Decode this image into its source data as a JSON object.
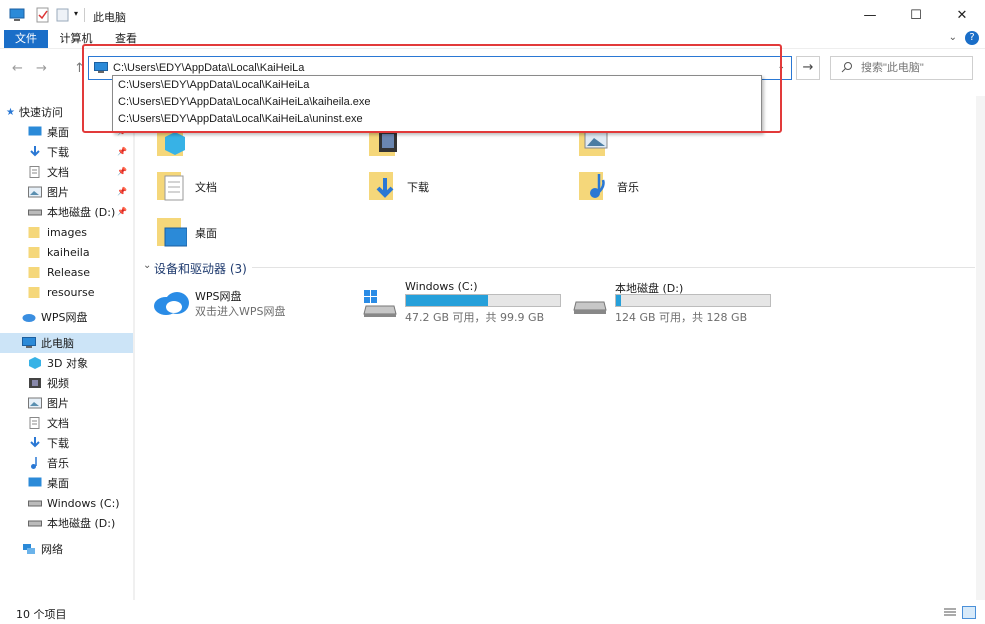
{
  "window": {
    "title": "此电脑",
    "minimize": "—",
    "maximize": "☐",
    "close": "✕"
  },
  "ribbon": {
    "tabs": [
      "文件",
      "计算机",
      "查看"
    ],
    "toggle": "⌄",
    "help": "?"
  },
  "nav": {
    "back": "←",
    "forward": "→",
    "up": "↑",
    "address_value": "C:\\Users\\EDY\\AppData\\Local\\KaiHeiLa",
    "dropdown": "⌄",
    "go": "→",
    "search_placeholder": "搜索\"此电脑\""
  },
  "autocomplete": [
    "C:\\Users\\EDY\\AppData\\Local\\KaiHeiLa",
    "C:\\Users\\EDY\\AppData\\Local\\KaiHeiLa\\kaiheila.exe",
    "C:\\Users\\EDY\\AppData\\Local\\KaiHeiLa\\uninst.exe"
  ],
  "sidebar": {
    "items": [
      {
        "label": "快速访问",
        "icon": "star-icon"
      },
      {
        "label": "桌面",
        "icon": "desktop-icon",
        "pinned": true
      },
      {
        "label": "下载",
        "icon": "download-icon",
        "pinned": true
      },
      {
        "label": "文档",
        "icon": "document-icon",
        "pinned": true
      },
      {
        "label": "图片",
        "icon": "pictures-icon",
        "pinned": true
      },
      {
        "label": "本地磁盘 (D:)",
        "icon": "drive-icon",
        "pinned": true
      },
      {
        "label": "images",
        "icon": "folder-icon"
      },
      {
        "label": "kaiheila",
        "icon": "folder-icon"
      },
      {
        "label": "Release",
        "icon": "folder-icon"
      },
      {
        "label": "resourse",
        "icon": "folder-icon"
      },
      {
        "label": "WPS网盘",
        "icon": "cloud-icon"
      },
      {
        "label": "此电脑",
        "icon": "computer-icon",
        "selected": true
      },
      {
        "label": "3D 对象",
        "icon": "3d-objects-icon"
      },
      {
        "label": "视频",
        "icon": "video-icon"
      },
      {
        "label": "图片",
        "icon": "pictures-icon"
      },
      {
        "label": "文档",
        "icon": "document-icon"
      },
      {
        "label": "下载",
        "icon": "download-icon"
      },
      {
        "label": "音乐",
        "icon": "music-icon"
      },
      {
        "label": "桌面",
        "icon": "desktop-icon"
      },
      {
        "label": "Windows (C:)",
        "icon": "drive-icon"
      },
      {
        "label": "本地磁盘 (D:)",
        "icon": "drive-icon"
      },
      {
        "label": "网络",
        "icon": "network-icon"
      }
    ],
    "pin_glyph": "📌"
  },
  "folders": [
    {
      "label": "",
      "icon": "3d-objects-icon"
    },
    {
      "label": "",
      "icon": "video-icon"
    },
    {
      "label": "",
      "icon": "pictures-icon"
    },
    {
      "label": "文档",
      "icon": "document-icon"
    },
    {
      "label": "下载",
      "icon": "download-icon"
    },
    {
      "label": "音乐",
      "icon": "music-icon"
    },
    {
      "label": "桌面",
      "icon": "desktop-icon"
    }
  ],
  "devices": {
    "group_title": "设备和驱动器 (3)",
    "chevron": "⌄",
    "items": [
      {
        "name": "WPS网盘",
        "subtitle": "双击进入WPS网盘",
        "icon": "cloud-icon"
      },
      {
        "name": "Windows (C:)",
        "info": "47.2 GB 可用，共 99.9 GB",
        "used_fraction": 0.53,
        "icon": "windows-drive-icon"
      },
      {
        "name": "本地磁盘 (D:)",
        "info": "124 GB 可用，共 128 GB",
        "used_fraction": 0.03,
        "icon": "drive-icon"
      }
    ]
  },
  "status": {
    "count": "10 个项目"
  },
  "colors": {
    "accent": "#1a6ec8",
    "highlight": "#e23a3a",
    "drive_fill": "#26a0da",
    "selected": "#cce4f7"
  }
}
